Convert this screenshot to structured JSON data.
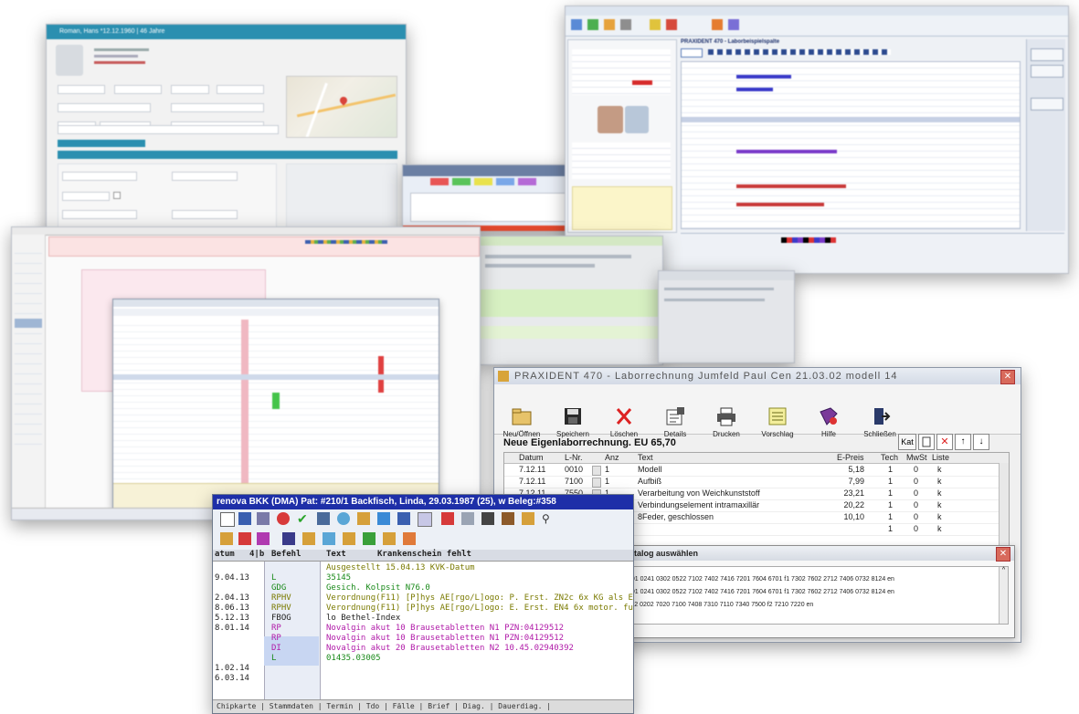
{
  "collage_title": "",
  "c1": {
    "title": "Roman, Hans *12.12.1960 | 46 Jahre"
  },
  "c3": {
    "title": "PRAXIDENT 470 - Laborbeispielspalte"
  },
  "c6": {
    "title": "PRAXIDENT 470 - Laborrechnung Jumfeld Paul Cen 21.03.02 modell 14",
    "toolbar": [
      {
        "label": "Neu/Öffnen",
        "icon": "folder-icon"
      },
      {
        "label": "Speichern",
        "icon": "save-icon"
      },
      {
        "label": "Löschen",
        "icon": "delete-icon"
      },
      {
        "label": "Details",
        "icon": "details-icon"
      },
      {
        "label": "Drucken",
        "icon": "print-icon"
      },
      {
        "label": "Vorschlag",
        "icon": "list-icon"
      },
      {
        "label": "Hilfe",
        "icon": "help-icon"
      },
      {
        "label": "Schließen",
        "icon": "exit-icon"
      }
    ],
    "heading": "Neue Eigenlaborrechnung. EU 65,70",
    "kat_label": "Kat",
    "columns": [
      "Datum",
      "L-Nr.",
      "Anz",
      "Text",
      "E-Preis",
      "Tech",
      "MwSt",
      "Liste"
    ],
    "rows": [
      {
        "datum": "7.12.11",
        "lnr": "0010",
        "anz": "1",
        "text": "Modell",
        "preis": "5,18",
        "tech": "1",
        "mwst": "0",
        "liste": "k"
      },
      {
        "datum": "7.12.11",
        "lnr": "7100",
        "anz": "1",
        "text": "Aufbiß",
        "preis": "7,99",
        "tech": "1",
        "mwst": "0",
        "liste": "k"
      },
      {
        "datum": "7.12.11",
        "lnr": "7550",
        "anz": "1",
        "text": "Verarbeitung von Weichkunststoff",
        "preis": "23,21",
        "tech": "1",
        "mwst": "0",
        "liste": "k"
      },
      {
        "datum": "",
        "lnr": "",
        "anz": "",
        "text": "Verbindungselement intramaxillär",
        "preis": "20,22",
        "tech": "1",
        "mwst": "0",
        "liste": "k"
      },
      {
        "datum": "",
        "lnr": "",
        "anz": "",
        "text": "8Feder, geschlossen",
        "preis": "10,10",
        "tech": "1",
        "mwst": "0",
        "liste": "k"
      },
      {
        "datum": "",
        "lnr": "",
        "anz": "",
        "text": "",
        "preis": "",
        "tech": "1",
        "mwst": "0",
        "liste": "k"
      }
    ],
    "subdialog_title": "katalog auswählen",
    "catalog_rows": [
      "001 0241 0302 0522 7102 7402 7416 7201 7604 6701 f1 7302 7602 2712 7406 0732 8124 en",
      "001 0241 0302 0522 7102 7402 7416 7201 7604 6701 f1 7302 7602 2712 7406 0732 8124 en",
      "112 0202 7020 7100 7408 7310 7110 7340 7500 f2 7210 7220 en"
    ]
  },
  "c7": {
    "title": "renova BKK (DMA) Pat: #210/1 Backfisch, Linda, 29.03.1987 (25), w Beleg:#358",
    "columns": [
      "atum",
      "4|b",
      "Befehl",
      "Text",
      "Krankenschein fehlt"
    ],
    "rows": [
      {
        "datum": "",
        "code": "",
        "text": "Ausgestellt 15.04.13 KVK-Datum",
        "color": "#7a7a00"
      },
      {
        "datum": "9.04.13",
        "code": "L",
        "text": "35145",
        "color": "#1a8a1a"
      },
      {
        "datum": "",
        "code": "GDG",
        "text": "Gesich. Kolpsit N76.0",
        "color": "#1a8a1a"
      },
      {
        "datum": "2.04.13",
        "code": "RPHV",
        "text": "Verordnung(F11) [P]hys AE[rgo/L]ogo: P. Erst. ZN2c 6x KG als E",
        "color": "#7a7a00"
      },
      {
        "datum": "8.06.13",
        "code": "RPHV",
        "text": "Verordnung(F11) [P]hys AE[rgo/L]ogo: E. Erst. EN4 6x motor. fu",
        "color": "#7a7a00"
      },
      {
        "datum": "5.12.13",
        "code": "FBOG",
        "text": "lo Bethel-Index",
        "color": "#222222"
      },
      {
        "datum": "8.01.14",
        "code": "RP",
        "text": "Novalgin akut 10 Brausetabletten N1 PZN:04129512",
        "color": "#b01aa8"
      },
      {
        "datum": "",
        "code": "RP",
        "text": "Novalgin akut 10 Brausetabletten N1 PZN:04129512",
        "color": "#b01aa8"
      },
      {
        "datum": "",
        "code": "DI",
        "text": "Novalgin akut 20 Brausetabletten N2 10.45.02940392",
        "color": "#b01aa8"
      },
      {
        "datum": "",
        "code": "L",
        "text": "01435.03005",
        "color": "#1a8a1a"
      },
      {
        "datum": "1.02.14",
        "code": "",
        "text": "",
        "color": "#222222"
      },
      {
        "datum": "6.03.14",
        "code": "",
        "text": "",
        "color": "#222222"
      }
    ],
    "statusbar": "Chipkarte | Stammdaten | Termin | Tdo | Fälle | Brief | Diag. | Dauerdiag. |"
  }
}
